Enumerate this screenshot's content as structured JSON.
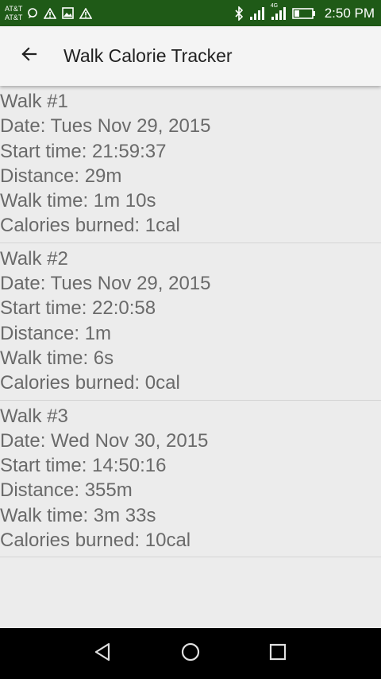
{
  "status_bar": {
    "carrier_top": "AT&T",
    "carrier_bottom": "AT&T",
    "network": "4G",
    "time": "2:50 PM",
    "icons": [
      "chat-icon",
      "warning-icon",
      "image-icon",
      "warning-icon",
      "bluetooth-icon",
      "signal-icon",
      "signal-4g-icon",
      "battery-icon"
    ]
  },
  "app_bar": {
    "title": "Walk Calorie Tracker",
    "back_icon": "arrow-back-icon"
  },
  "walks": [
    {
      "title": "Walk #1",
      "date": "Date: Tues Nov 29, 2015",
      "start": "Start time: 21:59:37",
      "distance": "Distance: 29m",
      "walk_time": "Walk time: 1m 10s",
      "calories": "Calories burned: 1cal"
    },
    {
      "title": "Walk #2",
      "date": "Date: Tues Nov 29, 2015",
      "start": "Start time: 22:0:58",
      "distance": "Distance: 1m",
      "walk_time": "Walk time: 6s",
      "calories": "Calories burned: 0cal"
    },
    {
      "title": "Walk #3",
      "date": "Date: Wed Nov 30, 2015",
      "start": "Start time: 14:50:16",
      "distance": "Distance: 355m",
      "walk_time": "Walk time: 3m 33s",
      "calories": "Calories burned: 10cal"
    }
  ],
  "nav_bar": {
    "icons": [
      "back-triangle-icon",
      "home-circle-icon",
      "recents-square-icon"
    ]
  },
  "colors": {
    "status_bar": "#1f5a17",
    "app_bar": "#f4f4f4",
    "background": "#ececec",
    "text": "#6a6a6a",
    "nav_bar": "#000000"
  }
}
